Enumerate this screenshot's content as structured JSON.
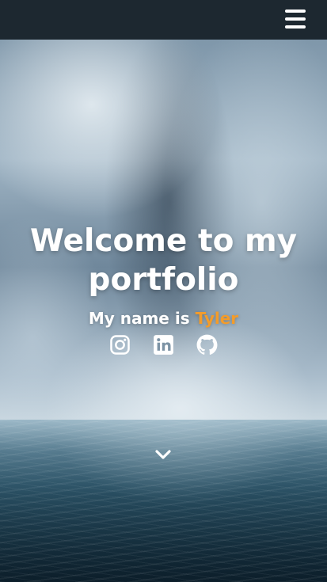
{
  "nav": {
    "menu_icon": "hamburger-menu-icon"
  },
  "hero": {
    "title": "Welcome to my portfolio",
    "intro": "My name is",
    "name": "Tyler",
    "accent_color": "#f39c2b"
  },
  "social_links": [
    {
      "icon": "instagram-icon"
    },
    {
      "icon": "linkedin-icon"
    },
    {
      "icon": "github-icon"
    }
  ],
  "scroll_icon": "chevron-down-icon"
}
